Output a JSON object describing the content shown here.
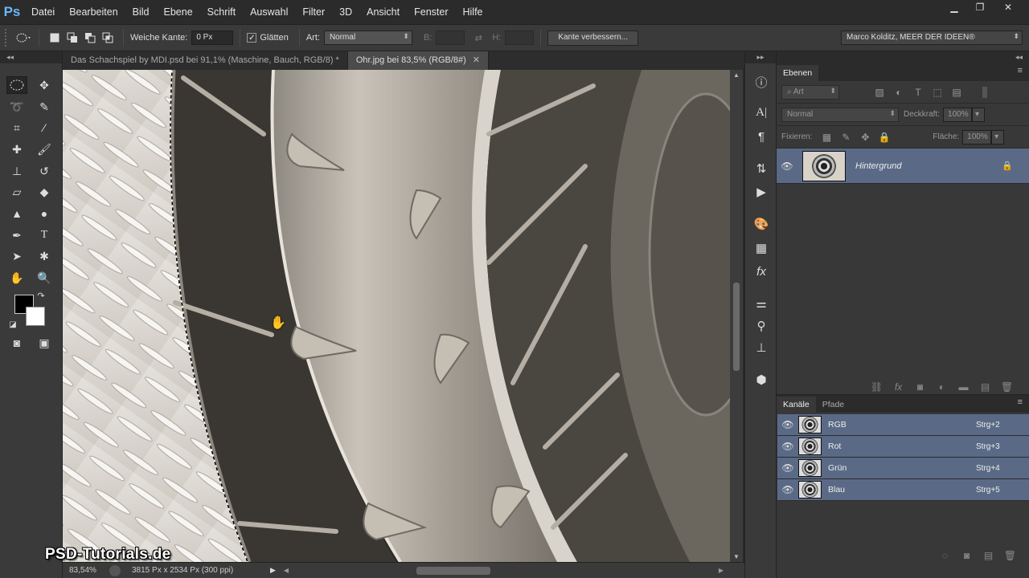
{
  "app": {
    "logo": "Ps"
  },
  "menu": [
    "Datei",
    "Bearbeiten",
    "Bild",
    "Ebene",
    "Schrift",
    "Auswahl",
    "Filter",
    "3D",
    "Ansicht",
    "Fenster",
    "Hilfe"
  ],
  "window_controls": {
    "minimize": "▁",
    "restore": "❐",
    "close": "✕"
  },
  "options": {
    "feather_label": "Weiche Kante:",
    "feather_value": "0 Px",
    "antialias_label": "Glätten",
    "style_label": "Art:",
    "style_value": "Normal",
    "width_label": "B:",
    "height_label": "H:",
    "refine_button": "Kante verbessern...",
    "workspace": "Marco Kolditz, MEER DER IDEEN®"
  },
  "doc_tabs": [
    {
      "label": "Das Schachspiel by MDI.psd bei 91,1% (Maschine, Bauch, RGB/8) *",
      "active": false
    },
    {
      "label": "Ohr.jpg bei 83,5% (RGB/8#)",
      "active": true
    }
  ],
  "status": {
    "zoom": "83,54%",
    "info": "3815 Px x 2534 Px (300 ppi)"
  },
  "watermark": "PSD-Tutorials.de",
  "layers_panel": {
    "tab": "Ebenen",
    "filter": "Art",
    "blend_mode": "Normal",
    "opacity_label": "Deckkraft:",
    "opacity_value": "100%",
    "lock_label": "Fixieren:",
    "fill_label": "Fläche:",
    "fill_value": "100%",
    "layers": [
      {
        "name": "Hintergrund",
        "locked": true
      }
    ]
  },
  "channels_panel": {
    "tabs": [
      "Kanäle",
      "Pfade"
    ],
    "channels": [
      {
        "name": "RGB",
        "shortcut": "Strg+2"
      },
      {
        "name": "Rot",
        "shortcut": "Strg+3"
      },
      {
        "name": "Grün",
        "shortcut": "Strg+4"
      },
      {
        "name": "Blau",
        "shortcut": "Strg+5"
      }
    ]
  },
  "colors": {
    "layer_selected": "#5a6a86",
    "panel_bg": "#383838",
    "foreground": "#000000",
    "background": "#ffffff"
  }
}
